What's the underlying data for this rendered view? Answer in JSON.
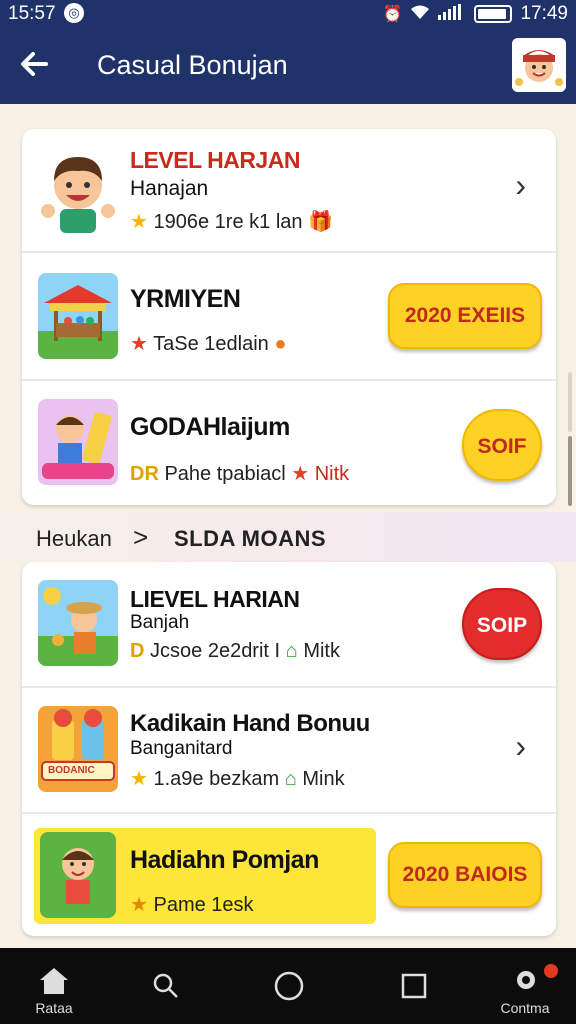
{
  "status": {
    "time_left": "15:57",
    "time_right": "17:49"
  },
  "appbar": {
    "title": "Casual Bonujan"
  },
  "card1": {
    "row1": {
      "title": "LEVEL HARJAN",
      "subtitle": "Hanajan",
      "meta": "1906e 1re k1 lan"
    },
    "row2": {
      "title": "YRMIYEN",
      "meta": "TaSe 1edlain",
      "button": "2020 EXEIIS"
    },
    "row3": {
      "title": "GODAHlaijum",
      "meta_prefix": "DR",
      "meta": "Pahe tpabiacl",
      "meta_suffix": "Nitk",
      "button": "SOIF"
    }
  },
  "section": {
    "label": "Heukan",
    "separator": ">",
    "label2": "SLDA MOANS"
  },
  "card2": {
    "row1": {
      "title": "LIEVEL HARIAN",
      "subtitle": "Banjah",
      "meta_prefix": "D",
      "meta": "Jcsoe 2e2drit I",
      "meta_suffix": "Mitk",
      "button": "SOIP"
    },
    "row2": {
      "title": "Kadikain Hand Bonuu",
      "subtitle": "Banganitard",
      "meta": "1.a9e bezkam",
      "meta_suffix": "Mink",
      "thumb_label": "BODANIC"
    },
    "row3": {
      "title": "Hadiahn Pomjan",
      "meta": "Pame 1esk",
      "button": "2020 BAIOIS"
    }
  },
  "bottomnav": {
    "home_label": "Rataa",
    "settings_label": "Contma"
  },
  "colors": {
    "appbar": "#1f3269",
    "accent_yellow": "#fdd126",
    "accent_red": "#e32c2c",
    "title_red": "#c62b1c"
  }
}
